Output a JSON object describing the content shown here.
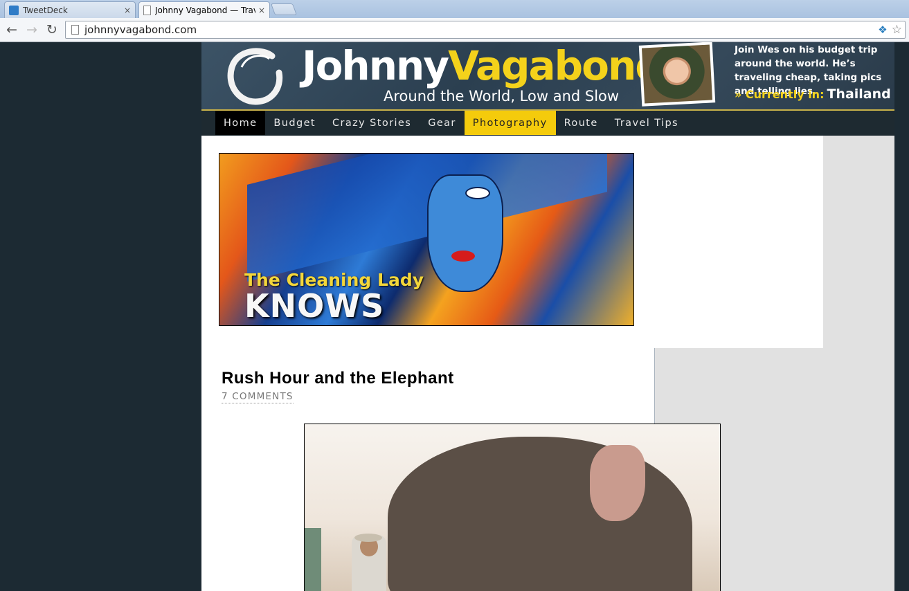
{
  "browser": {
    "tabs": [
      {
        "label": "TweetDeck",
        "active": false,
        "icon": "twitter-bird-icon"
      },
      {
        "label": "Johnny Vagabond — Trav",
        "active": true,
        "icon": "page-icon"
      }
    ],
    "close_glyph": "×",
    "url": "johnnyvagabond.com"
  },
  "header": {
    "brand_first": "Johnny",
    "brand_second": "Vagabond",
    "tagline": "Around the World, Low and Slow",
    "blurb": "Join Wes on his budget trip around the world. He’s traveling cheap, taking pics and telling lies.",
    "currently_label": "» Currently in:",
    "currently_place": "Thailand",
    "colors": {
      "accent_yellow": "#f4d21b",
      "nav_bg": "#1e2a31",
      "photo_tab": "#f4cb0c"
    }
  },
  "nav": {
    "items": [
      "Home",
      "Budget",
      "Crazy Stories",
      "Gear",
      "Photography",
      "Route",
      "Travel Tips"
    ],
    "active": "Home",
    "highlighted": "Photography"
  },
  "feature": {
    "line1": "The Cleaning Lady",
    "line2": "KNOWS"
  },
  "post": {
    "title": "Rush Hour and the Elephant",
    "comments": "7 COMMENTS"
  }
}
